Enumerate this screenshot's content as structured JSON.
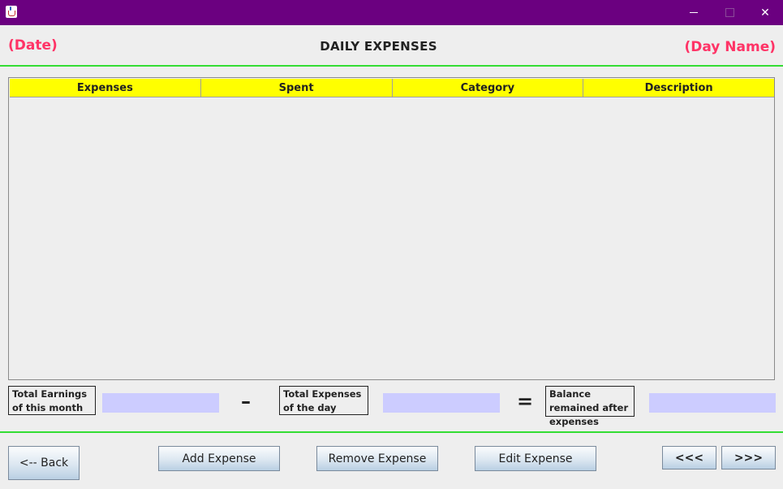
{
  "window": {
    "minimize_symbol": "",
    "close_symbol": "✕"
  },
  "header": {
    "date": "(Date)",
    "title": "DAILY EXPENSES",
    "day_name": "(Day Name)"
  },
  "table": {
    "columns": [
      "Expenses",
      "Spent",
      "Category",
      "Description"
    ],
    "rows": []
  },
  "summary": {
    "earnings_label": "Total Earnings of this month",
    "expenses_label": "Total Expenses of the day",
    "balance_label": "Balance remained after expenses",
    "earnings_value": "",
    "expenses_value": "",
    "balance_value": "",
    "minus_symbol": "–",
    "equals_symbol": "="
  },
  "buttons": {
    "back": "<-- Back",
    "add": "Add Expense",
    "remove": "Remove Expense",
    "edit": "Edit Expense",
    "prev": "<<<",
    "next": ">>>"
  },
  "colors": {
    "titlebar": "#6b0080",
    "accent_text": "#ff3366",
    "divider": "#33dd33",
    "table_header": "#ffff00",
    "value_field": "#ccccff"
  }
}
